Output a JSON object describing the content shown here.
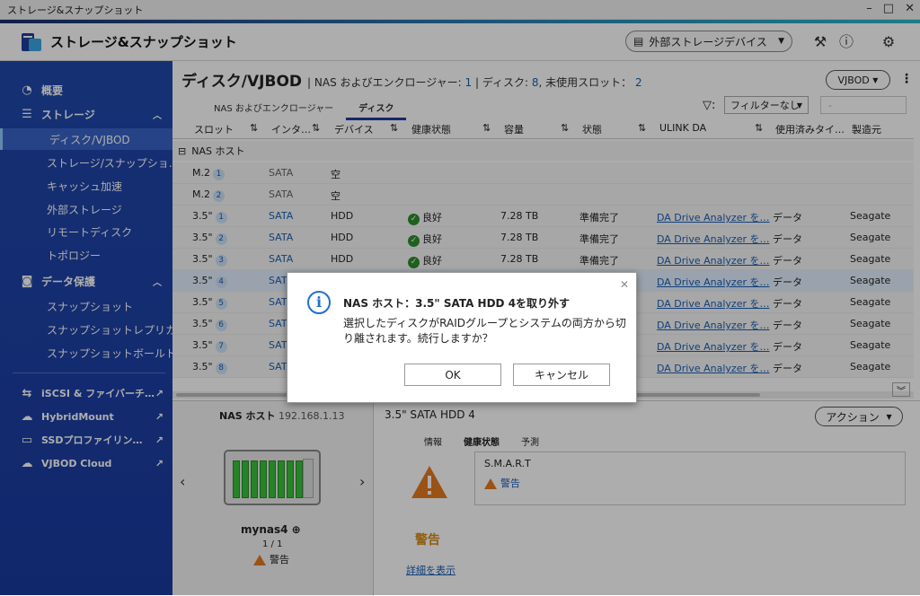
{
  "window": {
    "title": "ストレージ&スナップショット"
  },
  "app": {
    "title": "ストレージ&スナップショット",
    "ext_storage_label": "外部ストレージデバイス"
  },
  "sidebar": {
    "overview": "概要",
    "storage": "ストレージ",
    "storage_items": [
      "ディスク/VJBOD",
      "ストレージ/スナップショ…",
      "キャッシュ加速",
      "外部ストレージ",
      "リモートディスク",
      "トポロジー"
    ],
    "data_protection": "データ保護",
    "protection_items": [
      "スナップショット",
      "スナップショットレプリカ",
      "スナップショットボールト"
    ],
    "links": [
      "iSCSI & ファイバーチ…",
      "HybridMount",
      "SSDプロファイリン…",
      "VJBOD Cloud"
    ]
  },
  "page": {
    "title": "ディスク/VJBOD",
    "meta_prefix": "NAS およびエンクロージャー: ",
    "meta_nas": "1",
    "meta_disk_label": " | ディスク: ",
    "meta_disk": "8",
    "meta_free_label": ", 未使用スロット：",
    "meta_free": "2",
    "vjbod_btn": "VJBOD",
    "tabs": [
      "NAS およびエンクロージャー",
      "ディスク"
    ],
    "filter_value": "フィルターなし",
    "filter2_value": "-"
  },
  "table": {
    "headers": [
      "スロット",
      "インタ…",
      "デバイス",
      "健康状態",
      "容量",
      "状態",
      "ULINK DA",
      "使用済みタイ…",
      "製造元"
    ],
    "group": "NAS ホスト",
    "rows": [
      {
        "slot": "M.2",
        "num": "1",
        "iface": "SATA",
        "device": "空",
        "health": "",
        "cap": "",
        "state": "",
        "da": "",
        "used": "",
        "mfr": ""
      },
      {
        "slot": "M.2",
        "num": "2",
        "iface": "SATA",
        "device": "空",
        "health": "",
        "cap": "",
        "state": "",
        "da": "",
        "used": "",
        "mfr": ""
      },
      {
        "slot": "3.5\"",
        "num": "1",
        "iface": "SATA",
        "device": "HDD",
        "health": "良好",
        "cap": "7.28 TB",
        "state": "準備完了",
        "da": "DA Drive Analyzer を…",
        "used": "データ",
        "mfr": "Seagate"
      },
      {
        "slot": "3.5\"",
        "num": "2",
        "iface": "SATA",
        "device": "HDD",
        "health": "良好",
        "cap": "7.28 TB",
        "state": "準備完了",
        "da": "DA Drive Analyzer を…",
        "used": "データ",
        "mfr": "Seagate"
      },
      {
        "slot": "3.5\"",
        "num": "3",
        "iface": "SATA",
        "device": "HDD",
        "health": "良好",
        "cap": "7.28 TB",
        "state": "準備完了",
        "da": "DA Drive Analyzer を…",
        "used": "データ",
        "mfr": "Seagate"
      },
      {
        "slot": "3.5\"",
        "num": "4",
        "iface": "SATA",
        "device": "",
        "health": "",
        "cap": "",
        "state": "",
        "da": "DA Drive Analyzer を…",
        "used": "データ",
        "mfr": "Seagate"
      },
      {
        "slot": "3.5\"",
        "num": "5",
        "iface": "SATA",
        "device": "",
        "health": "",
        "cap": "",
        "state": "",
        "da": "DA Drive Analyzer を…",
        "used": "データ",
        "mfr": "Seagate"
      },
      {
        "slot": "3.5\"",
        "num": "6",
        "iface": "SATA",
        "device": "",
        "health": "",
        "cap": "",
        "state": "",
        "da": "DA Drive Analyzer を…",
        "used": "データ",
        "mfr": "Seagate"
      },
      {
        "slot": "3.5\"",
        "num": "7",
        "iface": "SATA",
        "device": "",
        "health": "",
        "cap": "",
        "state": "",
        "da": "DA Drive Analyzer を…",
        "used": "データ",
        "mfr": "Seagate"
      },
      {
        "slot": "3.5\"",
        "num": "8",
        "iface": "SATA",
        "device": "",
        "health": "",
        "cap": "",
        "state": "",
        "da": "DA Drive Analyzer を…",
        "used": "データ",
        "mfr": "Seagate"
      }
    ]
  },
  "nas_panel": {
    "label": "NAS ホスト",
    "ip": "192.168.1.13",
    "name": "mynas4",
    "page": "1 / 1",
    "warn": "警告"
  },
  "detail": {
    "title": "3.5\" SATA HDD 4",
    "action_btn": "アクション",
    "subtabs": [
      "情報",
      "健康状態",
      "予測"
    ],
    "status": "警告",
    "more_link": "詳細を表示",
    "smart_title": "S.M.A.R.T",
    "smart_status": "警告"
  },
  "dialog": {
    "title": "NAS ホスト：3.5\" SATA HDD 4を取り外す",
    "message": "選択したディスクがRAIDグループとシステムの両方から切り離されます。続行しますか？",
    "ok": "OK",
    "cancel": "キャンセル"
  },
  "colors": {
    "sidebar": "#2148ac",
    "accent": "#1a5fb4",
    "warning": "#e57a1f"
  }
}
